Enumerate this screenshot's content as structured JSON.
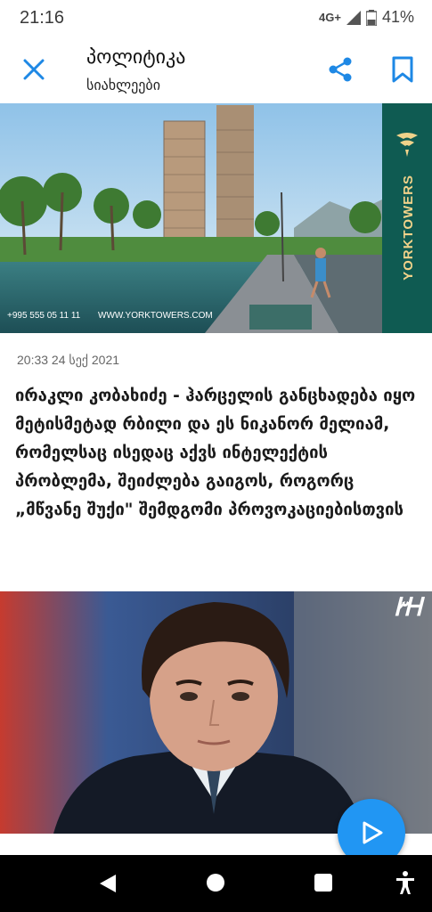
{
  "status": {
    "time": "21:16",
    "network": "4G+",
    "battery": "41%"
  },
  "app_bar": {
    "title": "პოლიტიკა",
    "subtitle": "სიახლეები"
  },
  "ad": {
    "brand": "YORKTOWERS",
    "phone": "+995 555 05 11 11",
    "url": "WWW.YORKTOWERS.COM"
  },
  "article": {
    "date": "20:33 24 სექ 2021",
    "title": "ირაკლი კობახიძე - ჰარცელის განცხადება იყო მეტისმეტად რბილი და ეს ნიკანორ მელიამ, რომელსაც ისედაც აქვს ინტელექტის პრობლემა, შეიძლება გაიგოს, როგორც „მწვანე შუქი\" შემდგომი პროვოკაციებისთვის"
  },
  "photo": {
    "channel_logo": "ᎨᎻ"
  },
  "colors": {
    "accent": "#2196f3",
    "icon_blue": "#1e88e5"
  }
}
